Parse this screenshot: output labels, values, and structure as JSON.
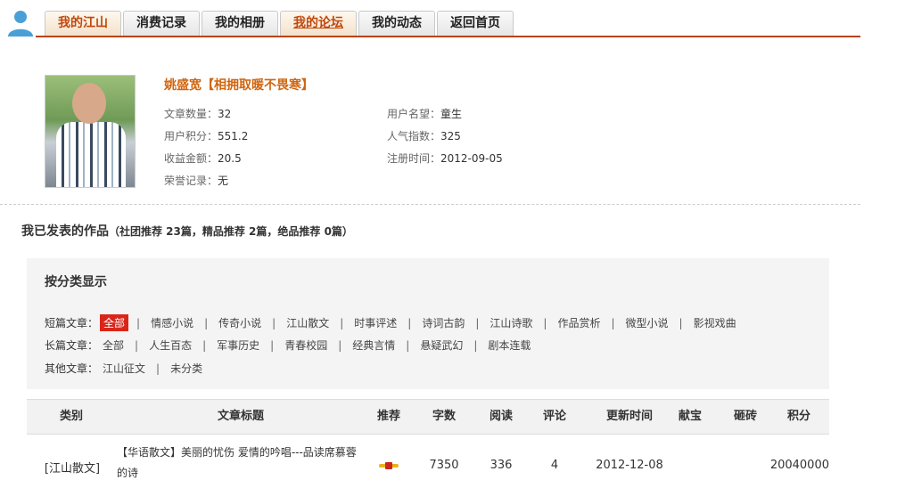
{
  "tabs": [
    {
      "label": "我的江山",
      "active": true,
      "underline": false
    },
    {
      "label": "消费记录",
      "active": false,
      "underline": false
    },
    {
      "label": "我的相册",
      "active": false,
      "underline": false
    },
    {
      "label": "我的论坛",
      "active": true,
      "underline": true
    },
    {
      "label": "我的动态",
      "active": false,
      "underline": false
    },
    {
      "label": "返回首页",
      "active": false,
      "underline": false
    }
  ],
  "profile": {
    "name": "姚盛宽【相拥取暖不畏寒】",
    "articles_label": "文章数量：",
    "articles": "32",
    "points_label": "用户积分：",
    "points": "551.2",
    "income_label": "收益金额：",
    "income": "20.5",
    "honor_label": "荣誉记录：",
    "honor": "无",
    "reputation_label": "用户名望：",
    "reputation": "童生",
    "popularity_label": "人气指数：",
    "popularity": "325",
    "regdate_label": "注册时间：",
    "regdate": "2012-09-05"
  },
  "works": {
    "title": "我已发表的作品",
    "summary": "（社团推荐 23篇，精品推荐 2篇，绝品推荐 0篇）"
  },
  "categories": {
    "heading": "按分类显示",
    "short": {
      "label": "短篇文章：",
      "items": [
        "全部",
        "情感小说",
        "传奇小说",
        "江山散文",
        "时事评述",
        "诗词古韵",
        "江山诗歌",
        "作品赏析",
        "微型小说",
        "影视戏曲"
      ]
    },
    "long": {
      "label": "长篇文章：",
      "items": [
        "全部",
        "人生百态",
        "军事历史",
        "青春校园",
        "经典言情",
        "悬疑武幻",
        "剧本连载"
      ]
    },
    "other": {
      "label": "其他文章：",
      "items": [
        "江山征文",
        "未分类"
      ]
    }
  },
  "table": {
    "headers": [
      "类别",
      "文章标题",
      "推荐",
      "字数",
      "阅读",
      "评论",
      "更新时间",
      "献宝",
      "砸砖",
      "积分"
    ],
    "rows": [
      {
        "category": "[江山散文]",
        "title_line1": "【华语散文】美丽的忧伤 爱情的吟唱---品读席慕蓉",
        "title_line2": "的诗",
        "words": "7350",
        "reads": "336",
        "comments": "4",
        "updated": "2012-12-08",
        "treasure": "",
        "bricks": "",
        "score": "20040000"
      }
    ]
  }
}
